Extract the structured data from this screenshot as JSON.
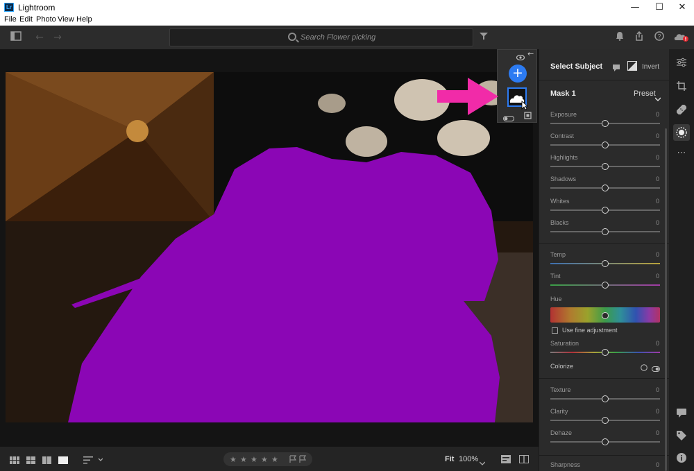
{
  "window": {
    "title": "Lightroom",
    "app_icon": "Lr",
    "controls": {
      "minimize": "—",
      "maximize": "☐",
      "close": "✕"
    }
  },
  "menu": [
    "File",
    "Edit",
    "Photo",
    "View",
    "Help"
  ],
  "toolbar": {
    "search_placeholder": "Search Flower picking",
    "icons": [
      "panel-toggle-icon",
      "back-arrow-icon",
      "forward-arrow-icon",
      "filter-icon",
      "bell-icon",
      "share-icon",
      "help-icon",
      "cloud-sync-icon"
    ]
  },
  "mask_panel": {
    "add_label": "+"
  },
  "edit_panel": {
    "header": "Select Subject",
    "invert_label": "Invert",
    "mask_name": "Mask 1",
    "preset_label": "Preset",
    "sliders": [
      {
        "label": "Exposure",
        "value": "0",
        "pos": 0.5
      },
      {
        "label": "Contrast",
        "value": "0",
        "pos": 0.5
      },
      {
        "label": "Highlights",
        "value": "0",
        "pos": 0.5
      },
      {
        "label": "Shadows",
        "value": "0",
        "pos": 0.5
      },
      {
        "label": "Whites",
        "value": "0",
        "pos": 0.5
      },
      {
        "label": "Blacks",
        "value": "0",
        "pos": 0.5
      },
      {
        "label": "Temp",
        "value": "0",
        "pos": 0.5
      },
      {
        "label": "Tint",
        "value": "0",
        "pos": 0.5
      },
      {
        "label": "Hue",
        "value": "0",
        "pos": 0.5
      },
      {
        "label": "Saturation",
        "value": "0",
        "pos": 0.5
      },
      {
        "label": "Texture",
        "value": "0",
        "pos": 0.5
      },
      {
        "label": "Clarity",
        "value": "0",
        "pos": 0.5
      },
      {
        "label": "Dehaze",
        "value": "0",
        "pos": 0.5
      },
      {
        "label": "Sharpness",
        "value": "0",
        "pos": 0.5
      }
    ],
    "fine_adjust_label": "Use fine adjustment",
    "colorize_label": "Colorize"
  },
  "bottom_bar": {
    "fit_label": "Fit",
    "zoom": "100%"
  },
  "colors": {
    "accent": "#2c7bf2",
    "mask_overlay": "#8b06b5",
    "annotation_arrow": "#f12ba8"
  }
}
